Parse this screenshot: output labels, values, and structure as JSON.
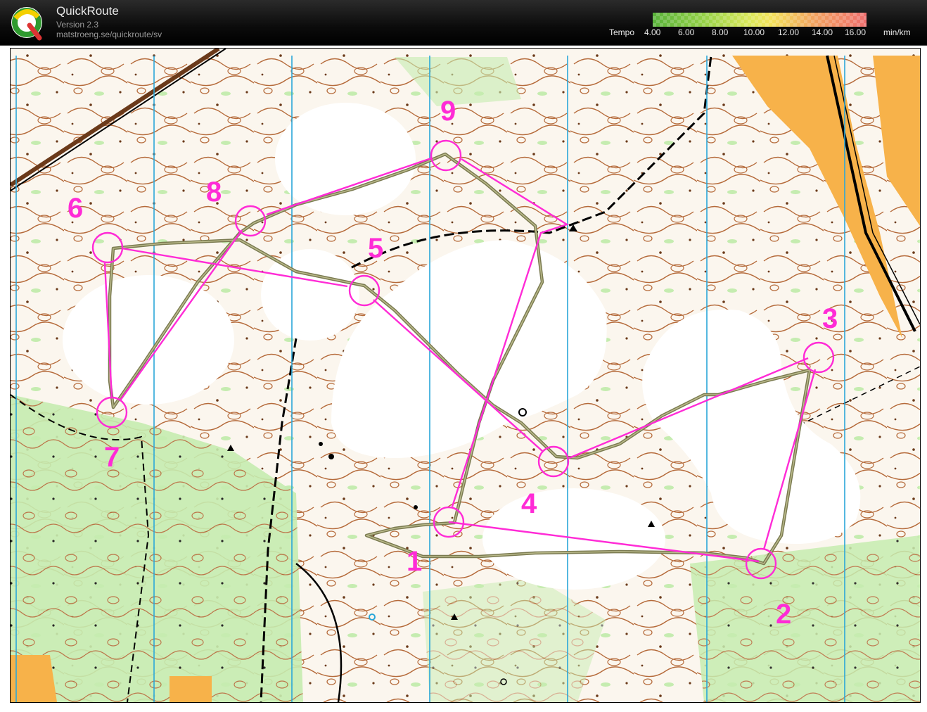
{
  "app": {
    "title": "QuickRoute",
    "version": "Version 2.3",
    "url": "matstroeng.se/quickroute/sv"
  },
  "tempo": {
    "label": "Tempo",
    "ticks": [
      "4.00",
      "6.00",
      "8.00",
      "10.00",
      "12.00",
      "14.00",
      "16.00"
    ],
    "unit": "min/km"
  },
  "map": {
    "controls": [
      {
        "number": "1"
      },
      {
        "number": "2"
      },
      {
        "number": "3"
      },
      {
        "number": "4"
      },
      {
        "number": "5"
      },
      {
        "number": "6"
      },
      {
        "number": "7"
      },
      {
        "number": "8"
      },
      {
        "number": "9"
      }
    ],
    "colors": {
      "course": "#ff2bd6",
      "route": "#8a8a5a",
      "contour": "#b56a3a",
      "green": "#9fe07a",
      "open": "#f7b24a",
      "north_lines": "#2aa7d9"
    }
  }
}
